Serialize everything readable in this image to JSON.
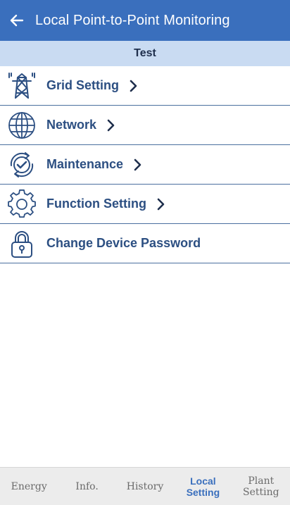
{
  "header": {
    "title": "Local Point-to-Point Monitoring",
    "back_icon": "arrow-left-icon",
    "background": "#3a6fbd"
  },
  "device": {
    "name": "Test"
  },
  "menu": [
    {
      "label": "Grid Setting",
      "icon": "transmission-tower-icon",
      "has_chevron": true
    },
    {
      "label": "Network",
      "icon": "globe-icon",
      "has_chevron": true
    },
    {
      "label": "Maintenance",
      "icon": "refresh-check-icon",
      "has_chevron": true
    },
    {
      "label": "Function Setting",
      "icon": "gear-icon",
      "has_chevron": true
    },
    {
      "label": "Change Device Password",
      "icon": "lock-icon",
      "has_chevron": false
    }
  ],
  "bottom_nav": [
    {
      "label": "Energy",
      "active": false
    },
    {
      "label": "Info.",
      "active": false
    },
    {
      "label": "History",
      "active": false
    },
    {
      "label": "Local\nSetting",
      "active": true
    },
    {
      "label": "Plant\nSetting",
      "active": false
    }
  ],
  "colors": {
    "accent": "#3a6fbd",
    "subheader": "#c9dbf2",
    "item_text": "#2c4f82"
  }
}
